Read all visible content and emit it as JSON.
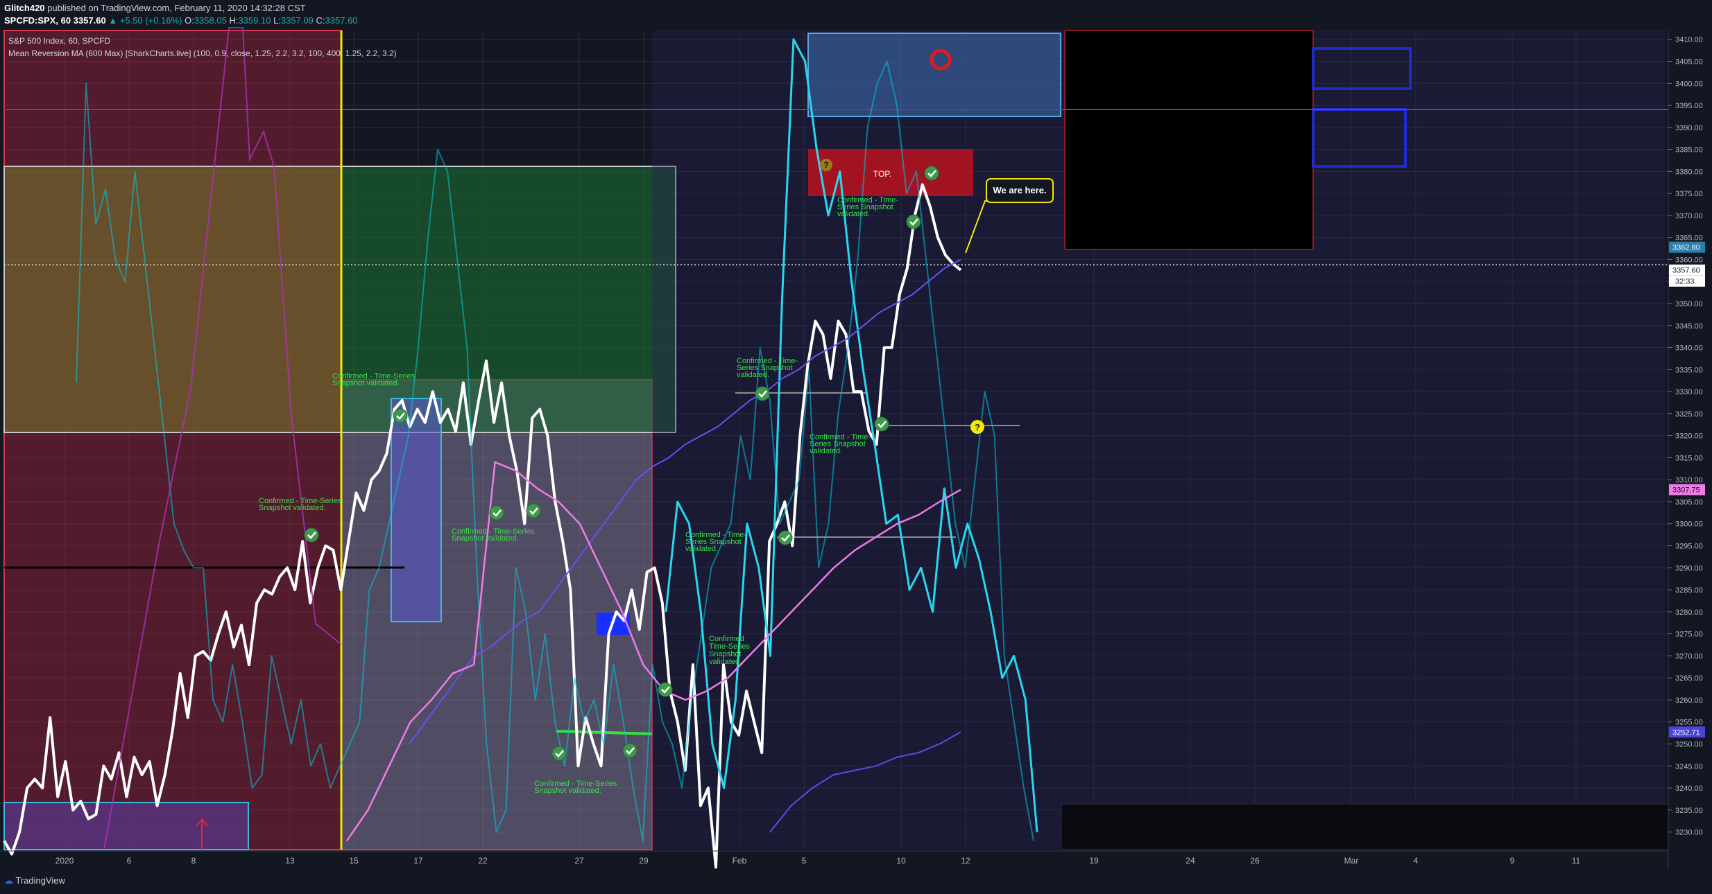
{
  "header": {
    "author": "Glitch420",
    "published": "published on TradingView.com, February 11, 2020 14:32:28 CST",
    "symbol": "SPCFD:SPX, 60",
    "last": "3357.60",
    "change": "▲ +5.50 (+0.16%)",
    "o_label": "O:",
    "o_value": "3358.05",
    "h_label": "H:",
    "h_value": "3359.10",
    "l_label": "L:",
    "l_value": "3357.09",
    "c_label": "C:",
    "c_value": "3357.60"
  },
  "legend": {
    "line1": "S&P 500 Index, 60, SPCFD",
    "line2": "Mean Reversion MA (600 Max) [SharkCharts.live] (100, 0.9, close, 1.25, 2.2, 3.2, 100, 400, 1.25, 2.2, 3.2)"
  },
  "footer": {
    "brand": "TradingView"
  },
  "chart_data": {
    "type": "line",
    "ylim": [
      3226,
      3412
    ],
    "y_ticks": [
      3230,
      3235,
      3240,
      3245,
      3250,
      3255,
      3260,
      3265,
      3270,
      3275,
      3280,
      3285,
      3290,
      3295,
      3300,
      3305,
      3310,
      3315,
      3320,
      3325,
      3330,
      3335,
      3340,
      3345,
      3350,
      3355,
      3360,
      3365,
      3370,
      3375,
      3380,
      3385,
      3390,
      3395,
      3400,
      3405,
      3410
    ],
    "x_ticks": [
      "2020",
      "6",
      "8",
      "13",
      "15",
      "17",
      "22",
      "27",
      "29",
      "Feb",
      "5",
      "10",
      "12",
      "19",
      "24",
      "26",
      "Mar",
      "4",
      "9",
      "11"
    ],
    "price_labels": {
      "cyan_high": "3362.80",
      "last": "3357.60",
      "countdown": "32:33",
      "pink": "3307.75",
      "blue": "3252.71"
    },
    "series": [
      {
        "values": [
          3228,
          3225,
          3230,
          3240,
          3242,
          3240,
          3256,
          3238,
          3246,
          3235,
          3237,
          3233,
          3234,
          3245,
          3242,
          3248,
          3238,
          3247,
          3243,
          3246,
          3236,
          3243,
          3253,
          3266,
          3256,
          3270,
          3271,
          3269,
          3275,
          3280,
          3272,
          3277,
          3268,
          3282,
          3285,
          3284,
          3288,
          3290,
          3285,
          3296,
          3282,
          3290,
          3295,
          3294,
          3285,
          3296,
          3307,
          3303,
          3310,
          3312,
          3316,
          3326,
          3328,
          3322,
          3326,
          3323,
          3330,
          3323,
          3326,
          3321,
          3332,
          3318,
          3328,
          3337,
          3323,
          3332,
          3320,
          3312,
          3300,
          3324,
          3326,
          3320,
          3305,
          3296,
          3285,
          3245,
          3256,
          3250,
          3245,
          3275,
          3280,
          3278,
          3285,
          3276,
          3289,
          3290,
          3282,
          3262,
          3255,
          3244,
          3268,
          3236,
          3240,
          3222,
          3268,
          3255,
          3252,
          3262,
          3255,
          3248,
          3296,
          3300,
          3305,
          3295,
          3320,
          3336,
          3346,
          3343,
          3333,
          3346,
          3343,
          3330,
          3330,
          3321,
          3318,
          3340,
          3340,
          3352,
          3358,
          3370,
          3377,
          3372,
          3365,
          3361,
          3359,
          3357.6
        ]
      },
      {
        "values": [
          3332,
          3400,
          3368,
          3376,
          3360,
          3355,
          3380,
          3360,
          3340,
          3320,
          3300,
          3294,
          3290,
          3290,
          3260,
          3255,
          3268,
          3255,
          3240,
          3243,
          3270,
          3260,
          3250,
          3260,
          3245,
          3250,
          3240,
          3245,
          3250,
          3255,
          3285,
          3290,
          3300,
          3310,
          3320,
          3340,
          3365,
          3385,
          3380,
          3360,
          3340,
          3290,
          3250,
          3230,
          3235,
          3290,
          3280,
          3260,
          3275,
          3255,
          3245,
          3265,
          3255,
          3260,
          3250,
          3268,
          3255,
          3240,
          3228,
          3268,
          3255,
          3250,
          3240,
          3260,
          3275,
          3290,
          3295,
          3300,
          3320,
          3310,
          3340,
          3328,
          3300,
          3305,
          3310,
          3335,
          3290,
          3300,
          3325,
          3340,
          3360,
          3390,
          3400,
          3405,
          3395,
          3375,
          3380,
          3360,
          3340,
          3320,
          3300,
          3290,
          3310,
          3330,
          3320,
          3270,
          3255,
          3240,
          3228
        ]
      },
      {
        "values": [
          3280,
          3305,
          3300,
          3280,
          3250,
          3240,
          3260,
          3300,
          3290,
          3270,
          3350,
          3410,
          3405,
          3385,
          3370,
          3380,
          3355,
          3335,
          3318,
          3300,
          3302,
          3285,
          3290,
          3280,
          3308,
          3290,
          3300,
          3292,
          3280,
          3265,
          3270,
          3260,
          3230
        ]
      },
      {
        "values": [
          3250,
          3255,
          3260,
          3265,
          3270,
          3272,
          3275,
          3278,
          3280,
          3285,
          3290,
          3295,
          3300,
          3305,
          3310,
          3313,
          3315,
          3318,
          3320,
          3322,
          3325,
          3328,
          3330,
          3333,
          3335,
          3338,
          3340,
          3342,
          3345,
          3348,
          3350,
          3352,
          3355,
          3358,
          3360
        ]
      },
      {
        "values": [
          3228,
          3235,
          3245,
          3255,
          3260,
          3266,
          3268,
          3314,
          3312,
          3308,
          3305,
          3300,
          3290,
          3280,
          3268,
          3262,
          3260,
          3262,
          3265,
          3270,
          3275,
          3280,
          3285,
          3290,
          3294,
          3297,
          3300,
          3302,
          3305,
          3307.75
        ]
      },
      {
        "values": [
          3230,
          3236,
          3240,
          3243,
          3244,
          3245,
          3247,
          3248,
          3250,
          3252.71
        ]
      }
    ],
    "annotations": {
      "confirmed_1": "Confirmed - Time-Series Snapshot validated.",
      "confirmed_2a": "Confirmed - Time-Series",
      "confirmed_2b": "Snapshot validated.",
      "confirmed_3a": "Confirmed - Time-Series",
      "confirmed_3b": "Snapshot validated.",
      "confirmed_4a": "Confirmed - Time-Series",
      "confirmed_4b": "Snapshot validated.",
      "confirmed_5a": "Confirmed - Time-",
      "confirmed_5b": "Series Snapshot",
      "confirmed_5c": "validated.",
      "confirmed_6a": "Confirmed",
      "confirmed_6b": "Time-Series",
      "confirmed_6c": "Snapshot",
      "confirmed_6d": "validated.",
      "confirmed_7a": "Confirmed - Time-",
      "confirmed_7b": "Series Snapshot",
      "confirmed_7c": "validated.",
      "confirmed_8a": "Confirmed - Time-",
      "confirmed_8b": "Series Snapshot",
      "confirmed_8c": "validated.",
      "confirmed_9a": "Confirmed - Time-",
      "confirmed_9b": "Series Snapshot",
      "confirmed_9c": "validated.",
      "confirmed_10a": "Confirmed - Time-Series",
      "confirmed_10b": "Snapshot validated.",
      "top": "TOP.",
      "we_are_here": "We are here.",
      "question": "?"
    }
  }
}
